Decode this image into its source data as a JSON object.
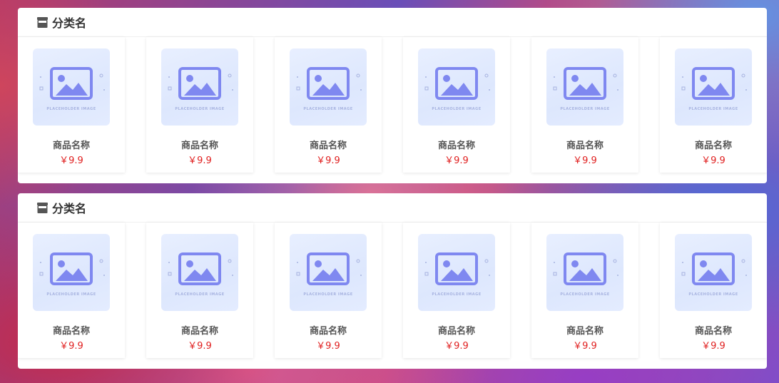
{
  "sections": [
    {
      "title": "分类名",
      "icon": "store-icon",
      "products": [
        {
          "name": "商品名称",
          "price": "￥9.9",
          "image_text": "PLACEHOLDER IMAGE"
        },
        {
          "name": "商品名称",
          "price": "￥9.9",
          "image_text": "PLACEHOLDER IMAGE"
        },
        {
          "name": "商品名称",
          "price": "￥9.9",
          "image_text": "PLACEHOLDER IMAGE"
        },
        {
          "name": "商品名称",
          "price": "￥9.9",
          "image_text": "PLACEHOLDER IMAGE"
        },
        {
          "name": "商品名称",
          "price": "￥9.9",
          "image_text": "PLACEHOLDER IMAGE"
        },
        {
          "name": "商品名称",
          "price": "￥9.9",
          "image_text": "PLACEHOLDER IMAGE"
        }
      ]
    },
    {
      "title": "分类名",
      "icon": "store-icon",
      "products": [
        {
          "name": "商品名称",
          "price": "￥9.9",
          "image_text": "PLACEHOLDER IMAGE"
        },
        {
          "name": "商品名称",
          "price": "￥9.9",
          "image_text": "PLACEHOLDER IMAGE"
        },
        {
          "name": "商品名称",
          "price": "￥9.9",
          "image_text": "PLACEHOLDER IMAGE"
        },
        {
          "name": "商品名称",
          "price": "￥9.9",
          "image_text": "PLACEHOLDER IMAGE"
        },
        {
          "name": "商品名称",
          "price": "￥9.9",
          "image_text": "PLACEHOLDER IMAGE"
        },
        {
          "name": "商品名称",
          "price": "￥9.9",
          "image_text": "PLACEHOLDER IMAGE"
        }
      ]
    }
  ],
  "colors": {
    "price": "#e02020",
    "title": "#333333",
    "placeholder_accent": "#7f88f0"
  }
}
